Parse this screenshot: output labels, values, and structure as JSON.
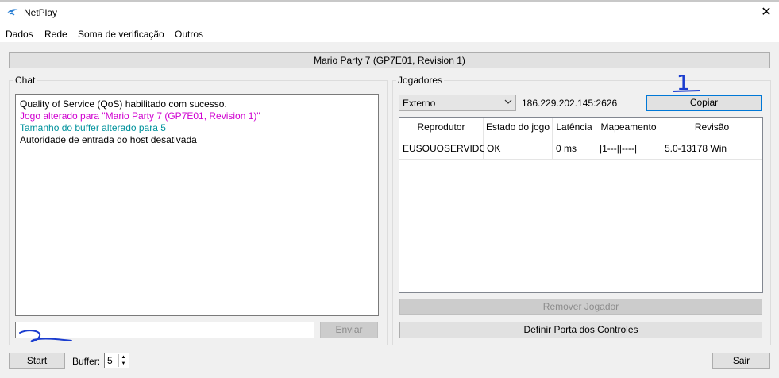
{
  "window": {
    "title": "NetPlay",
    "close_glyph": "✕",
    "icon": "dolphin-icon"
  },
  "menu": [
    "Dados",
    "Rede",
    "Soma de verificação",
    "Outros"
  ],
  "game_button": "Mario Party 7 (GP7E01, Revision 1)",
  "chat": {
    "group_title": "Chat",
    "messages": [
      {
        "text": "Quality of Service (QoS) habilitado com sucesso.",
        "color": "#000000"
      },
      {
        "text": "Jogo alterado para \"Mario Party 7 (GP7E01, Revision 1)\"",
        "color": "#d000d0"
      },
      {
        "text": "Tamanho do buffer alterado para 5",
        "color": "#00929c"
      },
      {
        "text": "Autoridade de entrada do host desativada",
        "color": "#000000"
      }
    ],
    "input_value": "",
    "send_label": "Enviar"
  },
  "players": {
    "group_title": "Jogadores",
    "connection_type": "Externo",
    "address": "186.229.202.145:2626",
    "copy_label": "Copiar",
    "columns": [
      "Reprodutor",
      "Estado do jogo",
      "Latência",
      "Mapeamento",
      "Revisão"
    ],
    "rows": [
      [
        "EUSOUOSERVIDOR",
        "OK",
        "0 ms",
        "|1---||----|",
        "5.0-13178 Win"
      ]
    ],
    "remove_label": "Remover Jogador",
    "ports_label": "Definir Porta dos Controles"
  },
  "bottom": {
    "start_label": "Start",
    "buffer_label": "Buffer:",
    "buffer_value": "5",
    "exit_label": "Sair"
  },
  "annotations": {
    "mark_1": "1",
    "ink_color": "#1a3ccf"
  }
}
